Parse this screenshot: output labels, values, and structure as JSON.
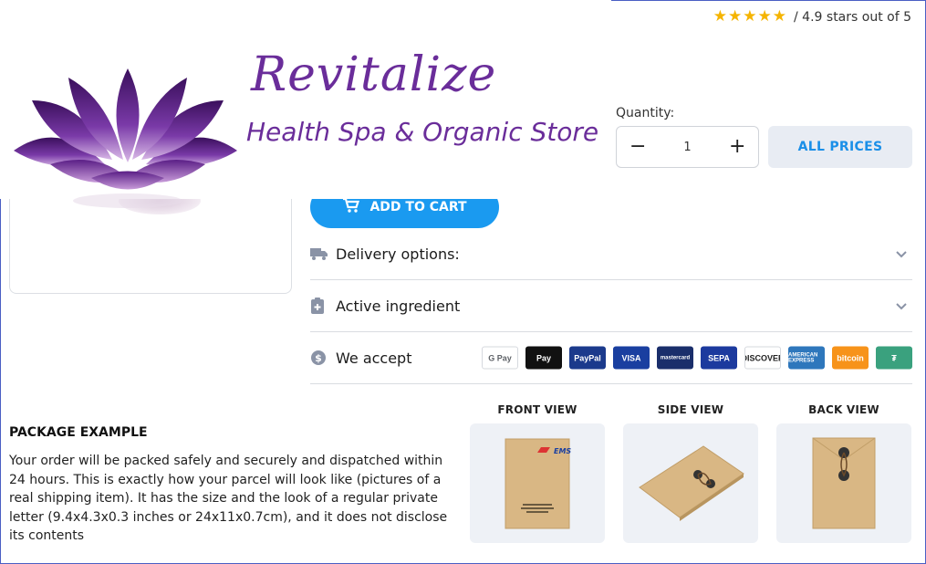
{
  "brand": {
    "name": "Revitalize",
    "tagline": "Health Spa & Organic Store"
  },
  "rating": {
    "stars": 5,
    "text": "/ 4.9 stars out of 5"
  },
  "quantity": {
    "label": "Quantity:",
    "value": "1",
    "decrement": "−",
    "increment": "+"
  },
  "buttons": {
    "all_prices": "ALL PRICES",
    "add_to_cart": "ADD TO CART"
  },
  "accordion": {
    "delivery": "Delivery options:",
    "ingredient": "Active ingredient",
    "accept": "We accept"
  },
  "payments": [
    {
      "name": "G Pay",
      "bg": "#ffffff",
      "fg": "#5f6368",
      "icon": "google-pay-icon"
    },
    {
      "name": " Pay",
      "bg": "#111111",
      "fg": "#ffffff",
      "icon": "apple-pay-icon"
    },
    {
      "name": "PayPal",
      "bg": "#1b3a8c",
      "fg": "#ffffff",
      "icon": "paypal-icon"
    },
    {
      "name": "VISA",
      "bg": "#1a3fa0",
      "fg": "#ffffff",
      "icon": "visa-icon"
    },
    {
      "name": "mastercard",
      "bg": "#1a2e6b",
      "fg": "#ffffff",
      "icon": "mastercard-icon"
    },
    {
      "name": "SEPA",
      "bg": "#1c3a9e",
      "fg": "#ffffff",
      "icon": "sepa-icon"
    },
    {
      "name": "DISCOVER",
      "bg": "#ffffff",
      "fg": "#222222",
      "icon": "discover-icon"
    },
    {
      "name": "AMERICAN EXPRESS",
      "bg": "#2e77bc",
      "fg": "#ffffff",
      "icon": "amex-icon"
    },
    {
      "name": "bitcoin",
      "bg": "#f7931a",
      "fg": "#ffffff",
      "icon": "bitcoin-icon"
    },
    {
      "name": "₮",
      "bg": "#3aa17e",
      "fg": "#ffffff",
      "icon": "tether-icon"
    }
  ],
  "package": {
    "title": "PACKAGE EXAMPLE",
    "text": "Your order will be packed safely and securely and dispatched within 24 hours. This is exactly how your parcel will look like (pictures of a real shipping item). It has the size and the look of a regular private letter (9.4x4.3x0.3 inches or 24x11x0.7cm), and it does not disclose its contents",
    "views": [
      "FRONT VIEW",
      "SIDE VIEW",
      "BACK VIEW"
    ],
    "stamp": "EMS"
  },
  "colors": {
    "accent": "#1a9af0",
    "brand_purple": "#6a2d9a",
    "star": "#f5b400"
  }
}
